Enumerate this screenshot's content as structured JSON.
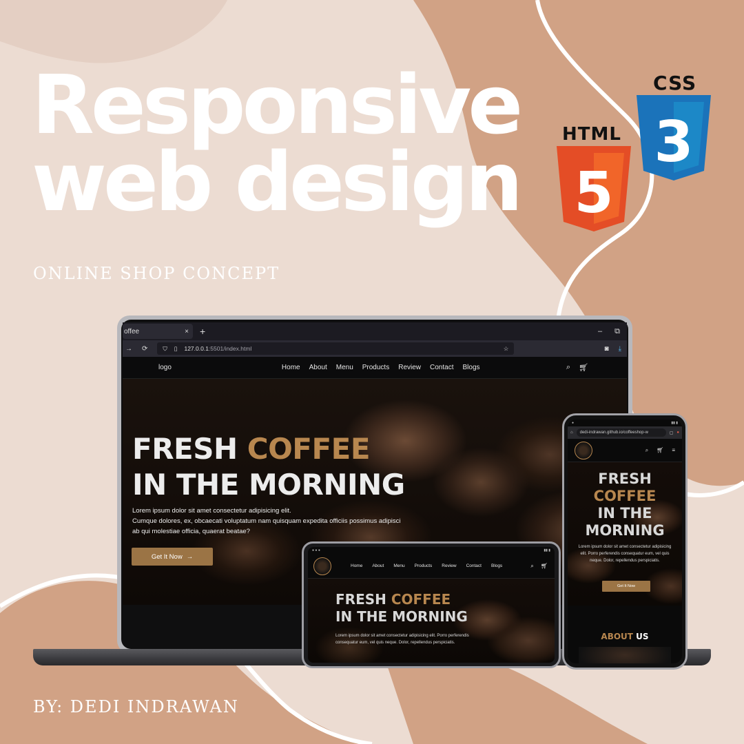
{
  "poster": {
    "headline_line1": "Responsive",
    "headline_line2": "web design",
    "subtitle": "ONLINE SHOP CONCEPT",
    "byline": "BY: DEDI INDRAWAN",
    "tech": {
      "html_label": "HTML",
      "html_digit": "5",
      "css_label": "CSS",
      "css_digit": "3"
    },
    "colors": {
      "background": "#ecdcd2",
      "blob": "#d1a285",
      "html_orange": "#e44d26",
      "css_blue": "#1b73ba",
      "accent_gold": "#b8874f"
    }
  },
  "laptop": {
    "tab_title": "offee",
    "tab_close": "×",
    "tab_new": "+",
    "window_minimize": "–",
    "window_restore": "⧉",
    "url_prefix": "127.0.0.1",
    "url_rest": ":5501/index.html",
    "site": {
      "logo": "logo",
      "nav": [
        "Home",
        "About",
        "Menu",
        "Products",
        "Review",
        "Contact",
        "Blogs"
      ],
      "hero_title_1": "FRESH ",
      "hero_title_accent": "COFFEE",
      "hero_title_2": "IN THE MORNING",
      "hero_text_1": "Lorem ipsum dolor sit amet consectetur adipisicing elit.",
      "hero_text_2": "Cumque dolores, ex, obcaecati voluptatum nam quisquam expedita officiis possimus adipisci ab qui molestiae officia, quaerat beatae?",
      "hero_button": "Get It Now",
      "hero_button_arrow": "→"
    }
  },
  "tablet": {
    "nav": [
      "Home",
      "About",
      "Menu",
      "Products",
      "Review",
      "Contact",
      "Blogs"
    ],
    "hero_title_1": "FRESH ",
    "hero_title_accent": "COFFEE",
    "hero_title_2": "IN THE MORNING",
    "hero_text": "Lorem ipsum dolor sit amet consectetur adipisicing elit. Porro perferendis consequatur eum, vel quis neque. Dolor, repellendus perspiciatis."
  },
  "phone": {
    "url": "dedi-indrawan.github.io/coffeeshop-w",
    "hero_title_1": "FRESH",
    "hero_title_accent": "COFFEE",
    "hero_title_2": "IN THE",
    "hero_title_3": "MORNING",
    "hero_text": "Lorem ipsum dolor sit amet consectetur adipisicing elit. Porro perferendis consequatur eum, vel quis neque. Dolor, repellendus perspiciatis.",
    "hero_button": "Get It Now",
    "about_accent": "ABOUT",
    "about_white": " US"
  }
}
